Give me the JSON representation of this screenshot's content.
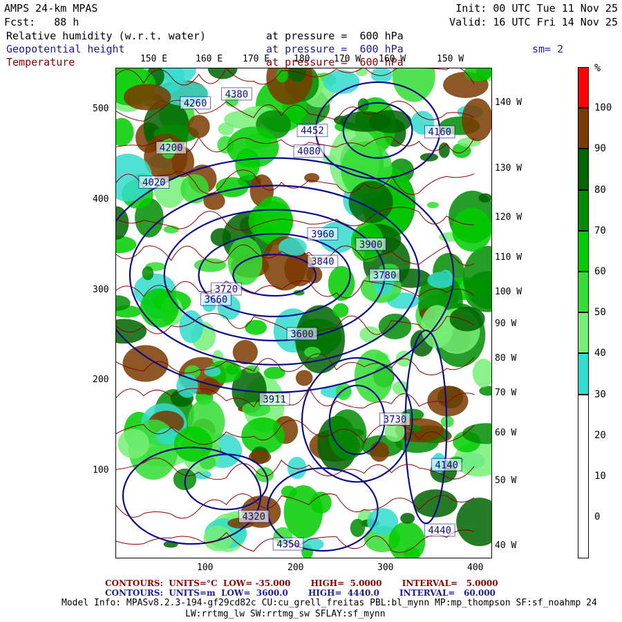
{
  "header": {
    "model": "AMPS 24-km MPAS",
    "forecast": "Fcst:   88 h",
    "init": "Init: 00 UTC Tue 11 Nov 25",
    "valid": "Valid: 16 UTC Fri 14 Nov 25",
    "fields": [
      {
        "name": "Relative humidity (w.r.t. water)",
        "level": "at pressure =  600 hPa"
      },
      {
        "name": "Geopotential height",
        "level": "at pressure =  600 hPa"
      },
      {
        "name": "Temperature",
        "level": "at pressure =  600 hPa"
      }
    ],
    "smoothing": "sm= 2"
  },
  "axes": {
    "top_lon": [
      "150 E",
      "160 E",
      "170 E",
      "180",
      "170 W",
      "160 W",
      "150 W"
    ],
    "right_lon": [
      "140 W",
      "130 W",
      "120 W",
      "110 W",
      "100 W",
      "90 W",
      "80 W",
      "70 W",
      "60 W",
      "50 W",
      "40 W"
    ],
    "left_y": [
      "500",
      "400",
      "300",
      "200",
      "100"
    ],
    "bottom_x": [
      "100",
      "200",
      "300",
      "400"
    ]
  },
  "colorbar": {
    "unit": "%",
    "labels": [
      "100",
      "90",
      "80",
      "70",
      "60",
      "50",
      "40",
      "30",
      "20",
      "10",
      "0"
    ],
    "colors": [
      "#ff0000",
      "#7a3a00",
      "#006400",
      "#008c00",
      "#00cc00",
      "#33dd33",
      "#77ee77",
      "#33dccc",
      "#ffffff"
    ]
  },
  "contour_labels": [
    "4380",
    "4260",
    "4452",
    "4160",
    "4200",
    "4080",
    "4020",
    "3960",
    "3900",
    "3840",
    "3780",
    "3720",
    "3660",
    "3600",
    "3911",
    "3730",
    "4140",
    "4320",
    "4440",
    "4350"
  ],
  "footer": {
    "temp": "CONTOURS:  UNITS=°C  LOW= -35.000       HIGH=  5.0000       INTERVAL=   5.0000",
    "height": "CONTOURS:  UNITS=m  LOW=  3600.0       HIGH=  4440.0       INTERVAL=   60.000",
    "model_info": "Model Info: MPASv8.2.3-194-gf29cd82c CU:cu_grell_freitas PBL:bl_mynn MP:mp_thompson SF:sf_noahmp 24",
    "model_info2": "LW:rrtmg_lw SW:rrtmg_sw SFLAY:sf_mynn"
  }
}
